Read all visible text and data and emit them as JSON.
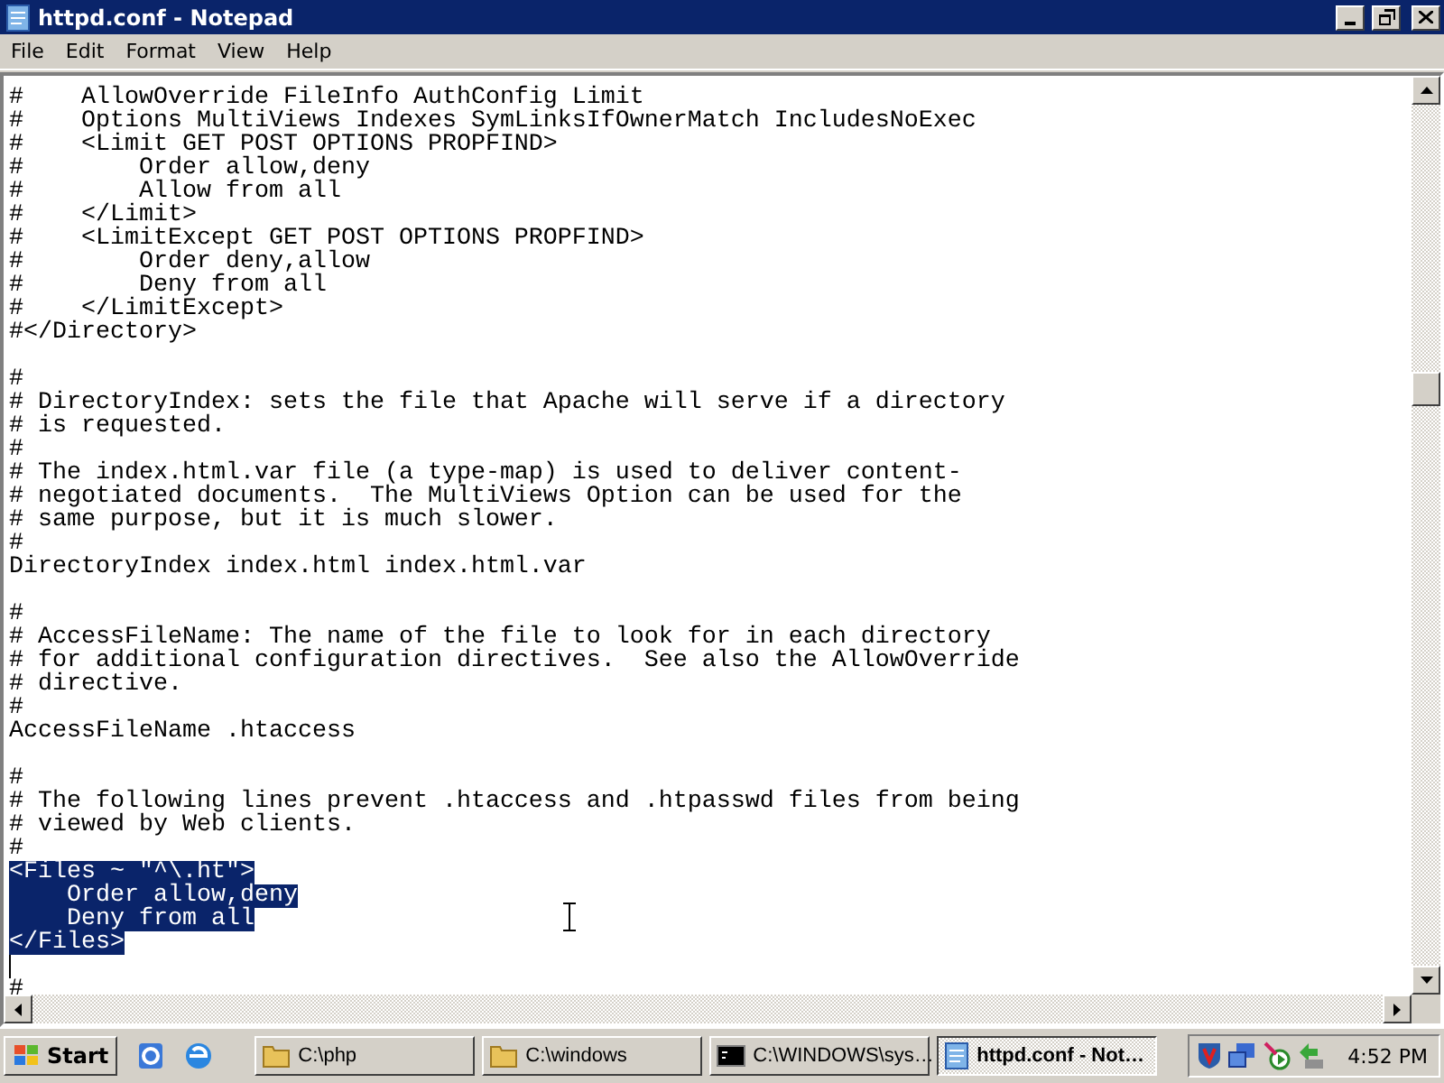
{
  "window": {
    "title": "httpd.conf - Notepad"
  },
  "menu": [
    {
      "label": "File"
    },
    {
      "label": "Edit"
    },
    {
      "label": "Format"
    },
    {
      "label": "View"
    },
    {
      "label": "Help"
    }
  ],
  "editor": {
    "lines": [
      {
        "kind": "text",
        "text": "#    AllowOverride FileInfo AuthConfig Limit",
        "selected": false
      },
      {
        "kind": "text",
        "text": "#    Options MultiViews Indexes SymLinksIfOwnerMatch IncludesNoExec",
        "selected": false
      },
      {
        "kind": "text",
        "text": "#    <Limit GET POST OPTIONS PROPFIND>",
        "selected": false
      },
      {
        "kind": "text",
        "text": "#        Order allow,deny",
        "selected": false
      },
      {
        "kind": "text",
        "text": "#        Allow from all",
        "selected": false
      },
      {
        "kind": "text",
        "text": "#    </Limit>",
        "selected": false
      },
      {
        "kind": "text",
        "text": "#    <LimitExcept GET POST OPTIONS PROPFIND>",
        "selected": false
      },
      {
        "kind": "text",
        "text": "#        Order deny,allow",
        "selected": false
      },
      {
        "kind": "text",
        "text": "#        Deny from all",
        "selected": false
      },
      {
        "kind": "text",
        "text": "#    </LimitExcept>",
        "selected": false
      },
      {
        "kind": "text",
        "text": "#</Directory>",
        "selected": false
      },
      {
        "kind": "blank"
      },
      {
        "kind": "text",
        "text": "#",
        "selected": false
      },
      {
        "kind": "text",
        "text": "# DirectoryIndex: sets the file that Apache will serve if a directory",
        "selected": false
      },
      {
        "kind": "text",
        "text": "# is requested.",
        "selected": false
      },
      {
        "kind": "text",
        "text": "#",
        "selected": false
      },
      {
        "kind": "text",
        "text": "# The index.html.var file (a type-map) is used to deliver content-",
        "selected": false
      },
      {
        "kind": "text",
        "text": "# negotiated documents.  The MultiViews Option can be used for the",
        "selected": false
      },
      {
        "kind": "text",
        "text": "# same purpose, but it is much slower.",
        "selected": false
      },
      {
        "kind": "text",
        "text": "#",
        "selected": false
      },
      {
        "kind": "text",
        "text": "DirectoryIndex index.html index.html.var",
        "selected": false
      },
      {
        "kind": "blank"
      },
      {
        "kind": "text",
        "text": "#",
        "selected": false
      },
      {
        "kind": "text",
        "text": "# AccessFileName: The name of the file to look for in each directory",
        "selected": false
      },
      {
        "kind": "text",
        "text": "# for additional configuration directives.  See also the AllowOverride",
        "selected": false
      },
      {
        "kind": "text",
        "text": "# directive.",
        "selected": false
      },
      {
        "kind": "text",
        "text": "#",
        "selected": false
      },
      {
        "kind": "text",
        "text": "AccessFileName .htaccess",
        "selected": false
      },
      {
        "kind": "blank"
      },
      {
        "kind": "text",
        "text": "#",
        "selected": false
      },
      {
        "kind": "text",
        "text": "# The following lines prevent .htaccess and .htpasswd files from being",
        "selected": false
      },
      {
        "kind": "text",
        "text": "# viewed by Web clients.",
        "selected": false
      },
      {
        "kind": "text",
        "text": "#",
        "selected": false
      },
      {
        "kind": "text",
        "text": "<Files ~ \"^\\.ht\">",
        "selected": true
      },
      {
        "kind": "text",
        "text": "    Order allow,deny",
        "selected": true
      },
      {
        "kind": "text",
        "text": "    Deny from all",
        "selected": true
      },
      {
        "kind": "text",
        "text": "</Files>",
        "selected": true
      },
      {
        "kind": "blank",
        "caret": true
      },
      {
        "kind": "text",
        "text": "#",
        "selected": false
      }
    ]
  },
  "taskbar": {
    "start": "Start",
    "tasks": [
      {
        "kind": "folder",
        "label": "C:\\php",
        "selected": false
      },
      {
        "kind": "folder",
        "label": "C:\\windows",
        "selected": false
      },
      {
        "kind": "console",
        "label": "C:\\WINDOWS\\sys…",
        "selected": false
      },
      {
        "kind": "notepad",
        "label": "httpd.conf - Not…",
        "selected": true
      }
    ],
    "clock": "4:52 PM"
  }
}
